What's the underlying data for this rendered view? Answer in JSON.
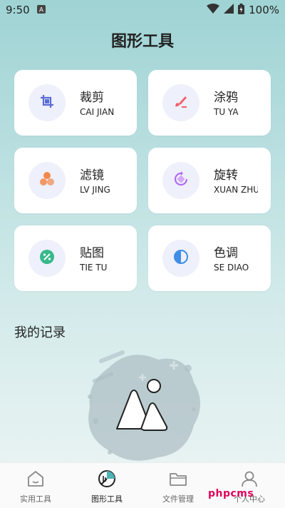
{
  "status_bar": {
    "time": "9:50",
    "notification_icon": "a-badge-icon",
    "battery_percent": "100%"
  },
  "page": {
    "title": "图形工具"
  },
  "tools": [
    {
      "cn": "裁剪",
      "en": "CAI JIAN",
      "icon": "crop-icon",
      "icon_color": "#5b6bd6"
    },
    {
      "cn": "涂鸦",
      "en": "TU YA",
      "icon": "brush-icon",
      "icon_color": "#f0606a"
    },
    {
      "cn": "滤镜",
      "en": "LV JING",
      "icon": "filter-icon",
      "icon_color": "#f2884a"
    },
    {
      "cn": "旋转",
      "en": "XUAN ZHUAN",
      "icon": "rotate-icon",
      "icon_color": "#b06bf2"
    },
    {
      "cn": "贴图",
      "en": "TIE TU",
      "icon": "sticker-icon",
      "icon_color": "#37b98a"
    },
    {
      "cn": "色调",
      "en": "SE DIAO",
      "icon": "tone-icon",
      "icon_color": "#3f8ee8"
    }
  ],
  "records": {
    "title": "我的记录",
    "empty_icon": "empty-image-illustration"
  },
  "nav": [
    {
      "label": "实用工具",
      "icon": "home-icon",
      "active": false
    },
    {
      "label": "图形工具",
      "icon": "chart-icon",
      "active": true
    },
    {
      "label": "文件管理",
      "icon": "folder-icon",
      "active": false
    },
    {
      "label": "个人中心",
      "icon": "person-icon",
      "active": false
    }
  ],
  "watermark": "phpcms"
}
